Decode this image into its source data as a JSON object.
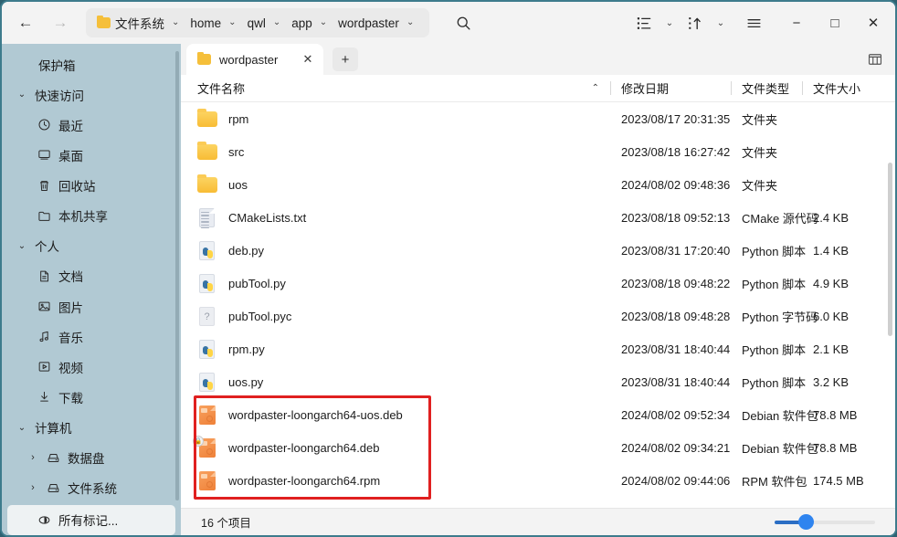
{
  "window": {
    "accent_color": "#2f84ef",
    "sidebar_color": "#b1c9d3",
    "highlight_color": "#e02020",
    "nav": {
      "back": "←",
      "forward": "→"
    },
    "controls": {
      "minimize": "−",
      "maximize": "□",
      "close": "✕"
    }
  },
  "breadcrumb": {
    "items": [
      {
        "label": "文件系统",
        "icon": "folder-icon",
        "chevron": "⌄"
      },
      {
        "label": "home",
        "chevron": "⌄"
      },
      {
        "label": "qwl",
        "chevron": "⌄"
      },
      {
        "label": "app",
        "chevron": "⌄"
      },
      {
        "label": "wordpaster",
        "chevron": "⌄"
      }
    ]
  },
  "toolbar": {
    "search_label": "search-icon",
    "view_label": "view-list-icon",
    "view_chevron": "⌄",
    "sort_label": "sort-icon",
    "sort_chevron": "⌄",
    "menu_label": "hamburger-menu-icon"
  },
  "tabs": {
    "active": {
      "label": "wordpaster",
      "close": "✕"
    },
    "new_tab": "+",
    "panel_toggle": "panel-toggle-icon"
  },
  "columns": {
    "name": "文件名称",
    "date": "修改日期",
    "type": "文件类型",
    "size": "文件大小",
    "sort_indicator": "⌃"
  },
  "sidebar": {
    "items": [
      {
        "label": "保护箱",
        "level": "top",
        "icon": null,
        "expander": null
      },
      {
        "label": "快速访问",
        "level": "group",
        "icon": null,
        "expander": "⌄"
      },
      {
        "label": "最近",
        "level": "item",
        "icon": "clock-icon"
      },
      {
        "label": "桌面",
        "level": "item",
        "icon": "monitor-icon"
      },
      {
        "label": "回收站",
        "level": "item",
        "icon": "trash-icon"
      },
      {
        "label": "本机共享",
        "level": "item",
        "icon": "folder-outline-icon"
      },
      {
        "label": "个人",
        "level": "group",
        "icon": null,
        "expander": "⌄"
      },
      {
        "label": "文档",
        "level": "item",
        "icon": "document-icon"
      },
      {
        "label": "图片",
        "level": "item",
        "icon": "image-icon"
      },
      {
        "label": "音乐",
        "level": "item",
        "icon": "music-note-icon"
      },
      {
        "label": "视频",
        "level": "item",
        "icon": "video-icon"
      },
      {
        "label": "下载",
        "level": "item",
        "icon": "download-icon"
      },
      {
        "label": "计算机",
        "level": "group",
        "icon": null,
        "expander": "⌄"
      },
      {
        "label": "数据盘",
        "level": "sub",
        "icon": "drive-icon",
        "expander": "›"
      },
      {
        "label": "文件系统",
        "level": "sub",
        "icon": "drive-icon",
        "expander": "›"
      },
      {
        "label": "所有标记...",
        "level": "item",
        "icon": "tag-icon",
        "selected": true
      }
    ]
  },
  "files": {
    "rows": [
      {
        "name": "rpm",
        "icon": "folder-icon",
        "date": "2023/08/17 20:31:35",
        "type": "文件夹",
        "size": ""
      },
      {
        "name": "src",
        "icon": "folder-icon",
        "date": "2023/08/18 16:27:42",
        "type": "文件夹",
        "size": ""
      },
      {
        "name": "uos",
        "icon": "folder-icon",
        "date": "2024/08/02 09:48:36",
        "type": "文件夹",
        "size": ""
      },
      {
        "name": "CMakeLists.txt",
        "icon": "text-document-icon",
        "date": "2023/08/18 09:52:13",
        "type": "CMake 源代码",
        "size": "2.4 KB"
      },
      {
        "name": "deb.py",
        "icon": "python-file-icon",
        "date": "2023/08/31 17:20:40",
        "type": "Python 脚本",
        "size": "1.4 KB"
      },
      {
        "name": "pubTool.py",
        "icon": "python-file-icon",
        "date": "2023/08/18 09:48:22",
        "type": "Python 脚本",
        "size": "4.9 KB"
      },
      {
        "name": "pubTool.pyc",
        "icon": "unknown-file-icon",
        "date": "2023/08/18 09:48:28",
        "type": "Python 字节码",
        "size": "6.0 KB"
      },
      {
        "name": "rpm.py",
        "icon": "python-file-icon",
        "date": "2023/08/31 18:40:44",
        "type": "Python 脚本",
        "size": "2.1 KB"
      },
      {
        "name": "uos.py",
        "icon": "python-file-icon",
        "date": "2023/08/31 18:40:44",
        "type": "Python 脚本",
        "size": "3.2 KB"
      },
      {
        "name": "wordpaster-loongarch64-uos.deb",
        "icon": "package-icon",
        "date": "2024/08/02 09:52:34",
        "type": "Debian 软件包",
        "size": "78.8 MB",
        "highlighted": true
      },
      {
        "name": "wordpaster-loongarch64.deb",
        "icon": "package-icon",
        "locked": true,
        "date": "2024/08/02 09:34:21",
        "type": "Debian 软件包",
        "size": "78.8 MB",
        "highlighted": true
      },
      {
        "name": "wordpaster-loongarch64.rpm",
        "icon": "package-icon",
        "date": "2024/08/02 09:44:06",
        "type": "RPM 软件包",
        "size": "174.5 MB",
        "highlighted": true
      }
    ]
  },
  "status": {
    "item_count": "16 个项目",
    "zoom_value": "30"
  }
}
